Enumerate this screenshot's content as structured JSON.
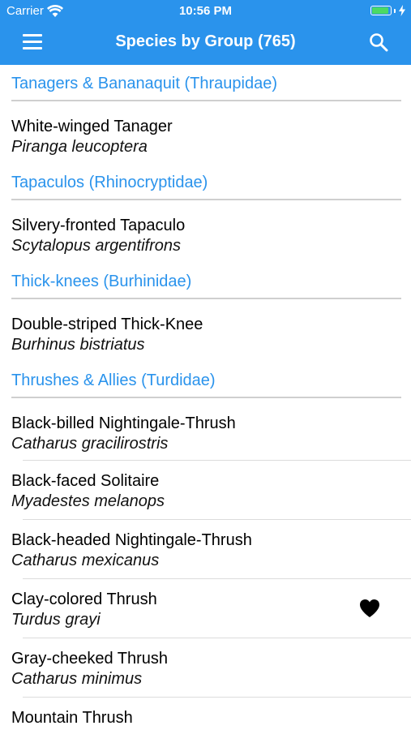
{
  "status_bar": {
    "carrier": "Carrier",
    "time": "10:56 PM",
    "wifi_icon": "wifi-icon",
    "battery_icon": "battery-icon",
    "battery_color": "#4cd964"
  },
  "navbar": {
    "title": "Species by Group (765)",
    "menu_icon": "hamburger-menu-icon",
    "search_icon": "search-icon",
    "background": "#2a93ec"
  },
  "colors": {
    "section_header": "#2a93ec",
    "favorite": "#000000"
  },
  "sections": [
    {
      "title": "Tanagers & Bananaquit (Thraupidae)",
      "species": [
        {
          "name": "White-winged Tanager",
          "scientific": "Piranga leucoptera",
          "favorite": false
        }
      ]
    },
    {
      "title": "Tapaculos (Rhinocryptidae)",
      "species": [
        {
          "name": "Silvery-fronted Tapaculo",
          "scientific": "Scytalopus argentifrons",
          "favorite": false
        }
      ]
    },
    {
      "title": "Thick-knees (Burhinidae)",
      "species": [
        {
          "name": "Double-striped Thick-Knee",
          "scientific": "Burhinus bistriatus",
          "favorite": false
        }
      ]
    },
    {
      "title": "Thrushes & Allies (Turdidae)",
      "species": [
        {
          "name": "Black-billed Nightingale-Thrush",
          "scientific": "Catharus gracilirostris",
          "favorite": false
        },
        {
          "name": "Black-faced Solitaire",
          "scientific": "Myadestes melanops",
          "favorite": false
        },
        {
          "name": "Black-headed Nightingale-Thrush",
          "scientific": "Catharus mexicanus",
          "favorite": false
        },
        {
          "name": "Clay-colored Thrush",
          "scientific": "Turdus grayi",
          "favorite": true
        },
        {
          "name": "Gray-cheeked Thrush",
          "scientific": "Catharus minimus",
          "favorite": false
        },
        {
          "name": "Mountain Thrush",
          "scientific": "",
          "favorite": false
        }
      ]
    }
  ]
}
